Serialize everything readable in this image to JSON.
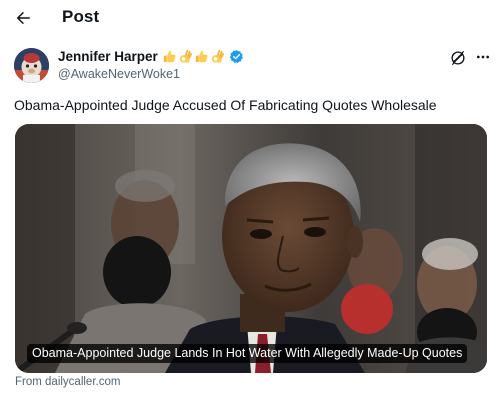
{
  "header": {
    "back_icon": "arrow-left-icon",
    "title": "Post"
  },
  "author": {
    "display_name": "Jennifer Harper",
    "name_emojis": [
      "thumbs-up",
      "ok-hand",
      "thumbs-up",
      "ok-hand"
    ],
    "verified_icon": "verified-badge-icon",
    "handle": "@AwakeNeverWoke1",
    "grok_icon": "grok-icon",
    "more_icon": "more-dots-icon"
  },
  "post": {
    "text": "Obama-Appointed Judge Accused Of Fabricating Quotes Wholesale"
  },
  "link_card": {
    "title": "Obama-Appointed Judge Lands In Hot Water With Allegedly Made-Up Quotes",
    "source": "From dailycaller.com"
  },
  "colors": {
    "text_primary": "#0f1419",
    "text_secondary": "#536471",
    "verified_blue": "#1d9bf0"
  }
}
